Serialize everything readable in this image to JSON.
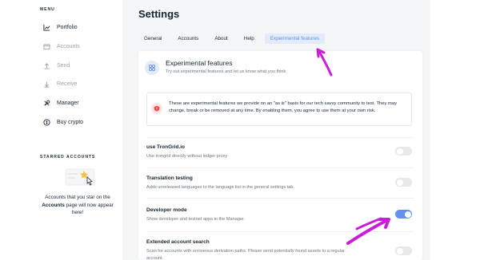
{
  "sidebar": {
    "menu_label": "MENU",
    "items": [
      {
        "label": "Portfolio",
        "icon": "chart-icon",
        "state": "active"
      },
      {
        "label": "Accounts",
        "icon": "wallet-icon",
        "state": "disabled"
      },
      {
        "label": "Send",
        "icon": "send-icon",
        "state": "disabled"
      },
      {
        "label": "Receive",
        "icon": "receive-icon",
        "state": "disabled"
      },
      {
        "label": "Manager",
        "icon": "tools-icon",
        "state": "active"
      },
      {
        "label": "Buy crypto",
        "icon": "coin-icon",
        "state": "active"
      }
    ],
    "starred_label": "STARRED ACCOUNTS",
    "starred_text_1": "Accounts that you star on the",
    "starred_text_bold": "Accounts",
    "starred_text_2": "page will now appear here!"
  },
  "main": {
    "title": "Settings",
    "tabs": [
      {
        "label": "General",
        "selected": false
      },
      {
        "label": "Accounts",
        "selected": false
      },
      {
        "label": "About",
        "selected": false
      },
      {
        "label": "Help",
        "selected": false
      },
      {
        "label": "Experimental features",
        "selected": true
      }
    ],
    "card": {
      "title": "Experimental features",
      "subtitle": "Try out experimental features and let us know what you think",
      "warning": "These are experimental features we provide on an \"as is\" basis for our tech savvy community to test. They may change, break or be removed at any time. By enabling them, you agree to use them at your own risk.",
      "settings": [
        {
          "title": "use TronGrid.io",
          "desc": "Use trongrid directly without ledger proxy",
          "enabled": false
        },
        {
          "title": "Translation testing",
          "desc": "Adds unreleased languages to the language list in the general settings tab.",
          "enabled": false
        },
        {
          "title": "Developer mode",
          "desc": "Show developer and testnet apps in the Manager.",
          "enabled": true
        },
        {
          "title": "Extended account search",
          "desc": "Scan for accounts with erroneous derivation paths. Please send potentially found assets to a regular account.",
          "enabled": false
        }
      ]
    }
  },
  "colors": {
    "accent": "#6490f1",
    "annotation": "#c81fd6",
    "text": "#142533",
    "muted": "#6b7580"
  }
}
